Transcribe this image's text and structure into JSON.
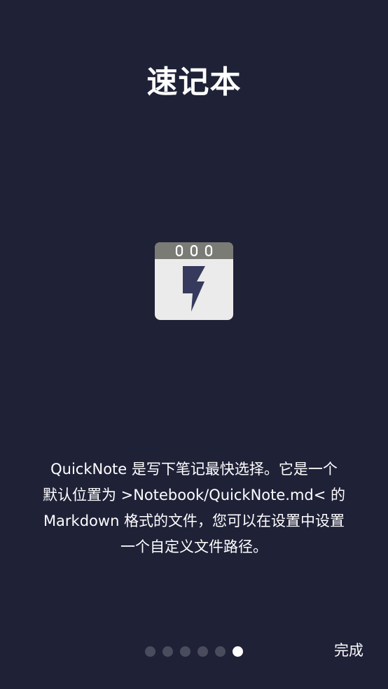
{
  "onboarding": {
    "title": "速记本",
    "icon": "quicknote-lightning-notebook-icon",
    "description_lines": [
      "QuickNote 是写下笔记最快选择。它是一个",
      "默认位置为 >Notebook/QuickNote.md< 的",
      "Markdown 格式的文件，您可以在设置中设置",
      "一个自定义文件路径。"
    ]
  },
  "pager": {
    "total_pages": 6,
    "current_page": 6
  },
  "footer": {
    "done_label": "完成"
  },
  "colors": {
    "background": "#1f2137",
    "dot_inactive": "#4a4c5e",
    "dot_active": "#ffffff",
    "icon_header": "#7b7b76",
    "icon_body": "#ebebeb",
    "icon_bolt": "#363a5c"
  }
}
